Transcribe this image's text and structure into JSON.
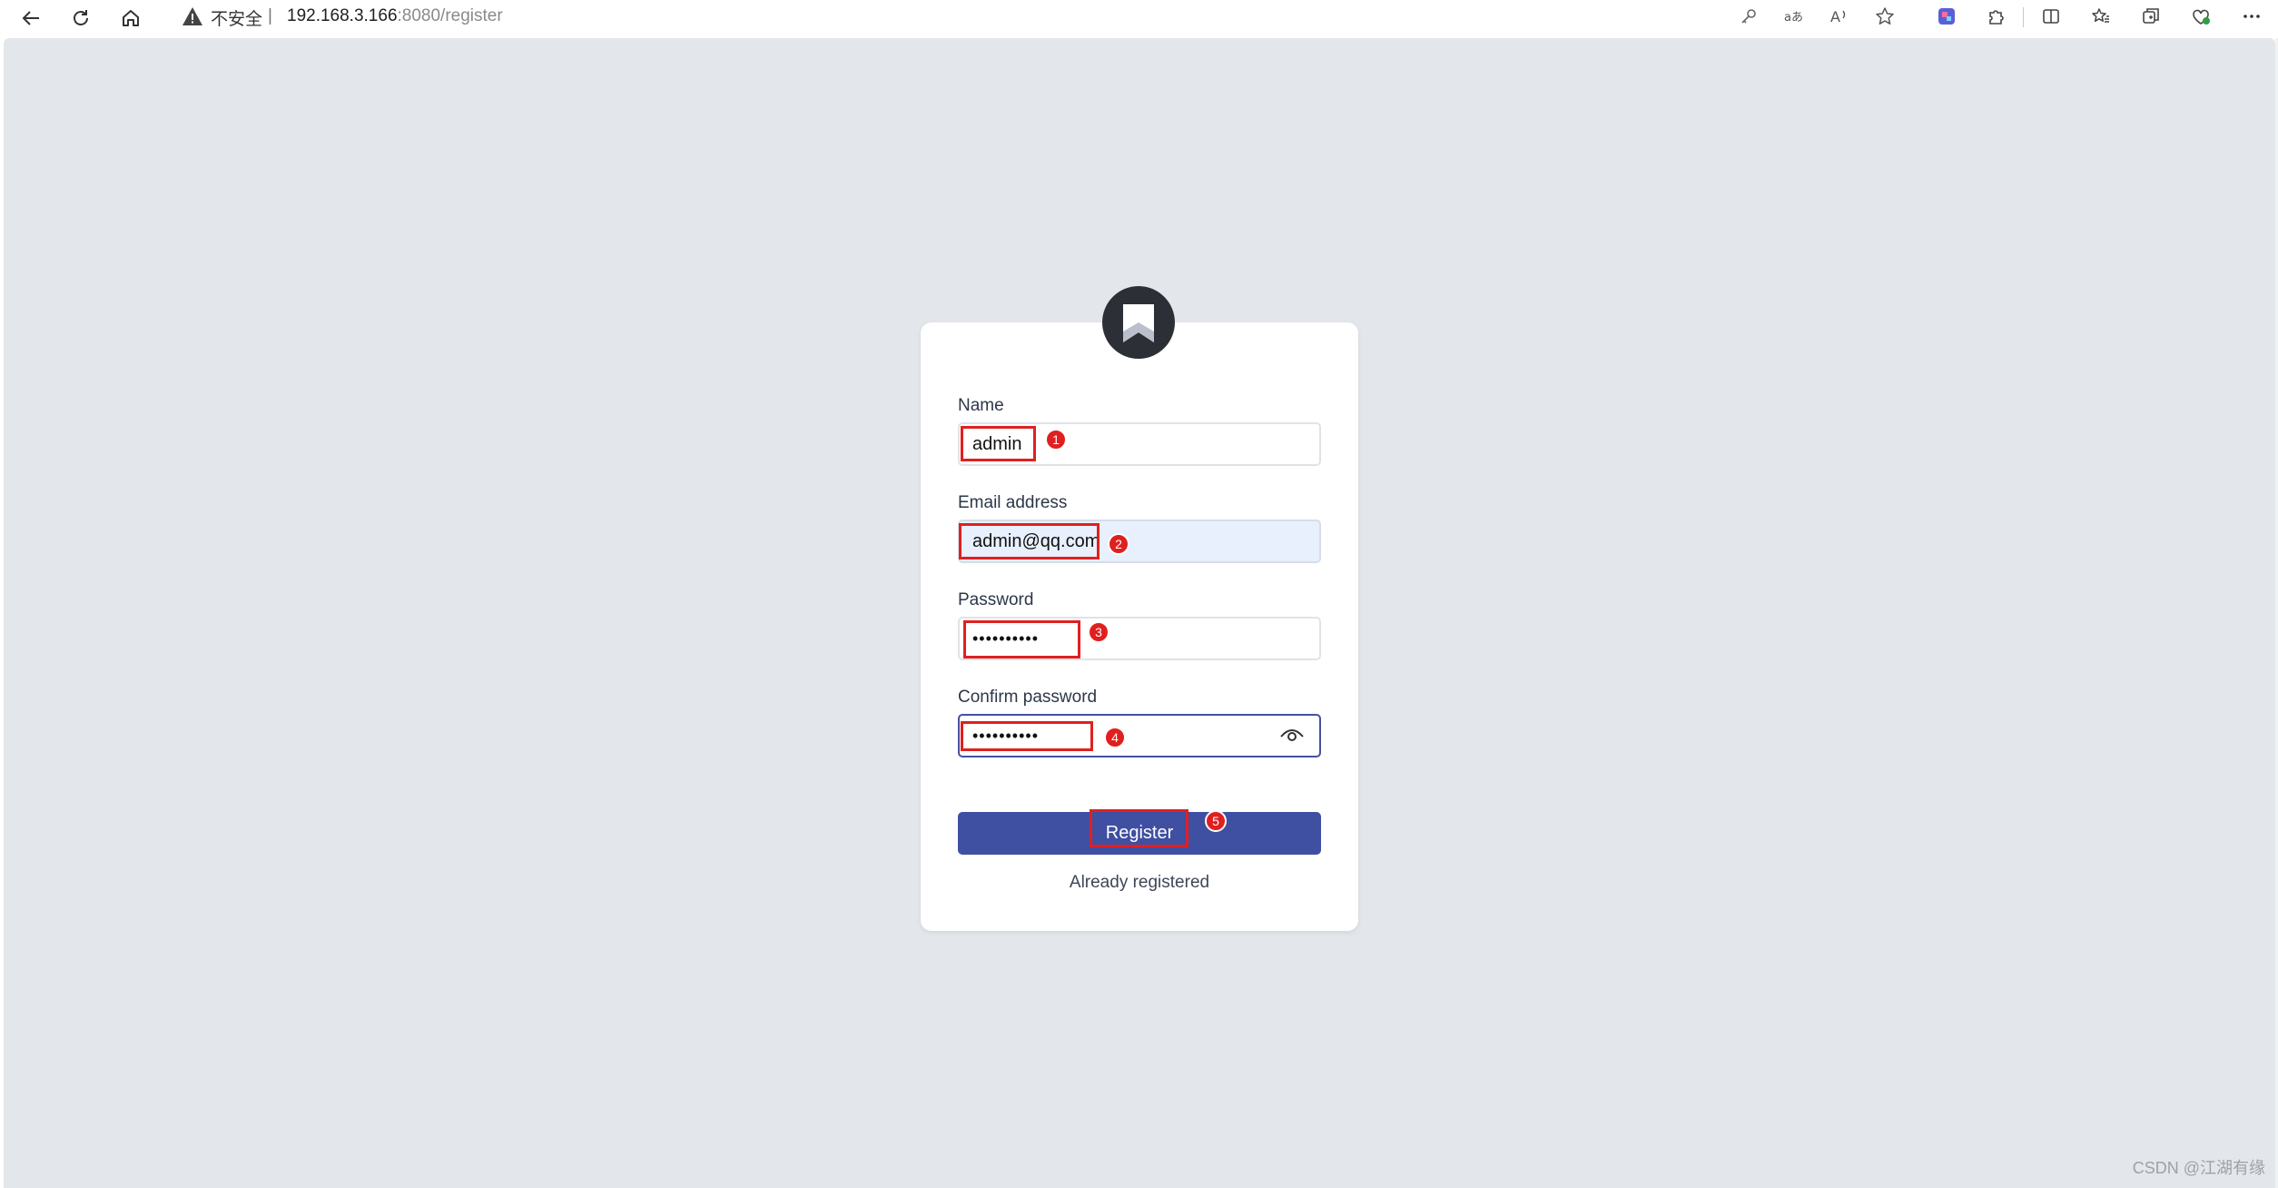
{
  "browser": {
    "security_label": "不安全",
    "separator": "|",
    "url_host": "192.168.3.166",
    "url_rest": ":8080/register"
  },
  "form": {
    "name_label": "Name",
    "name_value": "admin",
    "email_label": "Email address",
    "email_value": "admin@qq.com",
    "password_label": "Password",
    "password_value": "••••••••••",
    "confirm_label": "Confirm password",
    "confirm_value": "••••••••••",
    "register_label": "Register",
    "already_registered": "Already registered"
  },
  "annotations": {
    "n1": "1",
    "n2": "2",
    "n3": "3",
    "n4": "4",
    "n5": "5"
  },
  "watermark": "CSDN @江湖有缘",
  "colors": {
    "page_bg": "#e3e7eb",
    "button": "#3f4fa2",
    "annotation": "#e02020",
    "autofill": "#e8f0fe"
  }
}
